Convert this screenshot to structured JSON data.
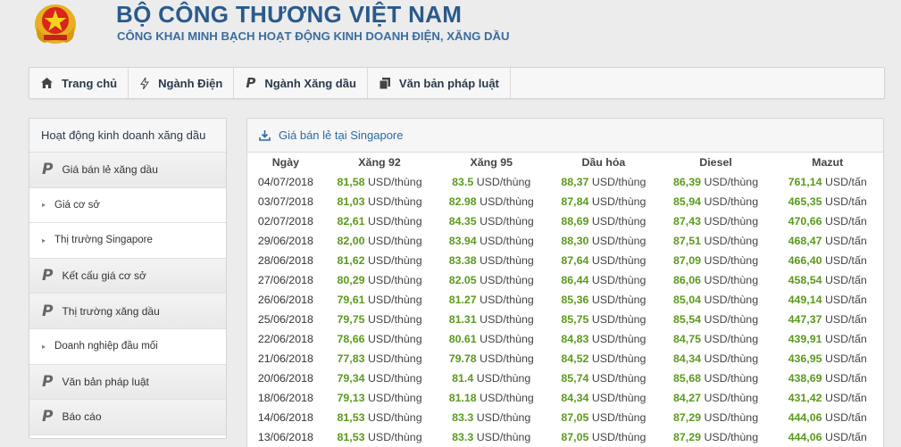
{
  "header": {
    "title": "BỘ CÔNG THƯƠNG VIỆT NAM",
    "subtitle": "CÔNG KHAI MINH BẠCH HOẠT ĐỘNG KINH DOANH ĐIỆN, XĂNG DẦU",
    "logo_icon": "national-emblem-icon"
  },
  "nav": {
    "items": [
      {
        "label": "Trang chủ",
        "icon": "home-icon"
      },
      {
        "label": "Ngành Điện",
        "icon": "bolt-icon"
      },
      {
        "label": "Ngành Xăng dầu",
        "icon": "p-icon"
      },
      {
        "label": "Văn bản pháp luật",
        "icon": "document-icon"
      }
    ]
  },
  "sidebar": {
    "title": "Hoạt động kinh doanh xăng dầu",
    "items": [
      {
        "label": "Giá bán lẻ xăng dầu",
        "type": "main"
      },
      {
        "label": "Giá cơ sở",
        "type": "sub"
      },
      {
        "label": "Thị trường Singapore",
        "type": "sub"
      },
      {
        "label": "Kết cấu giá cơ sở",
        "type": "main"
      },
      {
        "label": "Thị trường xăng dầu",
        "type": "main"
      },
      {
        "label": "Doanh nghiệp đầu mối",
        "type": "sub"
      },
      {
        "label": "Văn bản pháp luật",
        "type": "main"
      },
      {
        "label": "Báo cáo",
        "type": "main"
      }
    ]
  },
  "panel": {
    "title": "Giá bán lẻ tại Singapore",
    "icon": "download-icon",
    "columns": [
      "Ngày",
      "Xăng 92",
      "Xăng 95",
      "Dầu hỏa",
      "Diesel",
      "Mazut"
    ],
    "rows": [
      {
        "date": "04/07/2018",
        "values": [
          [
            "81,58",
            "USD/thùng"
          ],
          [
            "83.5",
            "USD/thùng"
          ],
          [
            "88,37",
            "USD/thùng"
          ],
          [
            "86,39",
            "USD/thùng"
          ],
          [
            "761,14",
            "USD/tấn"
          ]
        ]
      },
      {
        "date": "03/07/2018",
        "values": [
          [
            "81,03",
            "USD/thùng"
          ],
          [
            "82.98",
            "USD/thùng"
          ],
          [
            "87,84",
            "USD/thùng"
          ],
          [
            "85,94",
            "USD/thùng"
          ],
          [
            "465,35",
            "USD/tấn"
          ]
        ]
      },
      {
        "date": "02/07/2018",
        "values": [
          [
            "82,61",
            "USD/thùng"
          ],
          [
            "84.35",
            "USD/thùng"
          ],
          [
            "88,69",
            "USD/thùng"
          ],
          [
            "87,43",
            "USD/thùng"
          ],
          [
            "470,66",
            "USD/tấn"
          ]
        ]
      },
      {
        "date": "29/06/2018",
        "values": [
          [
            "82,00",
            "USD/thùng"
          ],
          [
            "83.94",
            "USD/thùng"
          ],
          [
            "88,30",
            "USD/thùng"
          ],
          [
            "87,51",
            "USD/thùng"
          ],
          [
            "468,47",
            "USD/tấn"
          ]
        ]
      },
      {
        "date": "28/06/2018",
        "values": [
          [
            "81,62",
            "USD/thùng"
          ],
          [
            "83.38",
            "USD/thùng"
          ],
          [
            "87,64",
            "USD/thùng"
          ],
          [
            "87,09",
            "USD/thùng"
          ],
          [
            "466,40",
            "USD/tấn"
          ]
        ]
      },
      {
        "date": "27/06/2018",
        "values": [
          [
            "80,29",
            "USD/thùng"
          ],
          [
            "82.05",
            "USD/thùng"
          ],
          [
            "86,44",
            "USD/thùng"
          ],
          [
            "86,06",
            "USD/thùng"
          ],
          [
            "458,54",
            "USD/tấn"
          ]
        ]
      },
      {
        "date": "26/06/2018",
        "values": [
          [
            "79,61",
            "USD/thùng"
          ],
          [
            "81.27",
            "USD/thùng"
          ],
          [
            "85,36",
            "USD/thùng"
          ],
          [
            "85,04",
            "USD/thùng"
          ],
          [
            "449,14",
            "USD/tấn"
          ]
        ]
      },
      {
        "date": "25/06/2018",
        "values": [
          [
            "79,75",
            "USD/thùng"
          ],
          [
            "81.31",
            "USD/thùng"
          ],
          [
            "85,75",
            "USD/thùng"
          ],
          [
            "85,54",
            "USD/thùng"
          ],
          [
            "447,37",
            "USD/tấn"
          ]
        ]
      },
      {
        "date": "22/06/2018",
        "values": [
          [
            "78,66",
            "USD/thùng"
          ],
          [
            "80.61",
            "USD/thùng"
          ],
          [
            "84,83",
            "USD/thùng"
          ],
          [
            "84,75",
            "USD/thùng"
          ],
          [
            "439,91",
            "USD/tấn"
          ]
        ]
      },
      {
        "date": "21/06/2018",
        "values": [
          [
            "77,83",
            "USD/thùng"
          ],
          [
            "79.78",
            "USD/thùng"
          ],
          [
            "84,52",
            "USD/thùng"
          ],
          [
            "84,34",
            "USD/thùng"
          ],
          [
            "436,95",
            "USD/tấn"
          ]
        ]
      },
      {
        "date": "20/06/2018",
        "values": [
          [
            "79,34",
            "USD/thùng"
          ],
          [
            "81.4",
            "USD/thùng"
          ],
          [
            "85,74",
            "USD/thùng"
          ],
          [
            "85,68",
            "USD/thùng"
          ],
          [
            "438,69",
            "USD/tấn"
          ]
        ]
      },
      {
        "date": "18/06/2018",
        "values": [
          [
            "79,13",
            "USD/thùng"
          ],
          [
            "81.18",
            "USD/thùng"
          ],
          [
            "84,34",
            "USD/thùng"
          ],
          [
            "84,27",
            "USD/thùng"
          ],
          [
            "431,42",
            "USD/tấn"
          ]
        ]
      },
      {
        "date": "14/06/2018",
        "values": [
          [
            "81,53",
            "USD/thùng"
          ],
          [
            "83.3",
            "USD/thùng"
          ],
          [
            "87,05",
            "USD/thùng"
          ],
          [
            "87,29",
            "USD/thùng"
          ],
          [
            "444,06",
            "USD/tấn"
          ]
        ]
      },
      {
        "date": "13/06/2018",
        "values": [
          [
            "81,53",
            "USD/thùng"
          ],
          [
            "83.3",
            "USD/thùng"
          ],
          [
            "87,05",
            "USD/thùng"
          ],
          [
            "87,29",
            "USD/thùng"
          ],
          [
            "444,06",
            "USD/tấn"
          ]
        ]
      }
    ]
  },
  "colors": {
    "title": "#2a5a8c",
    "value_green": "#5b9a1d",
    "link_blue": "#2b6aa3"
  }
}
